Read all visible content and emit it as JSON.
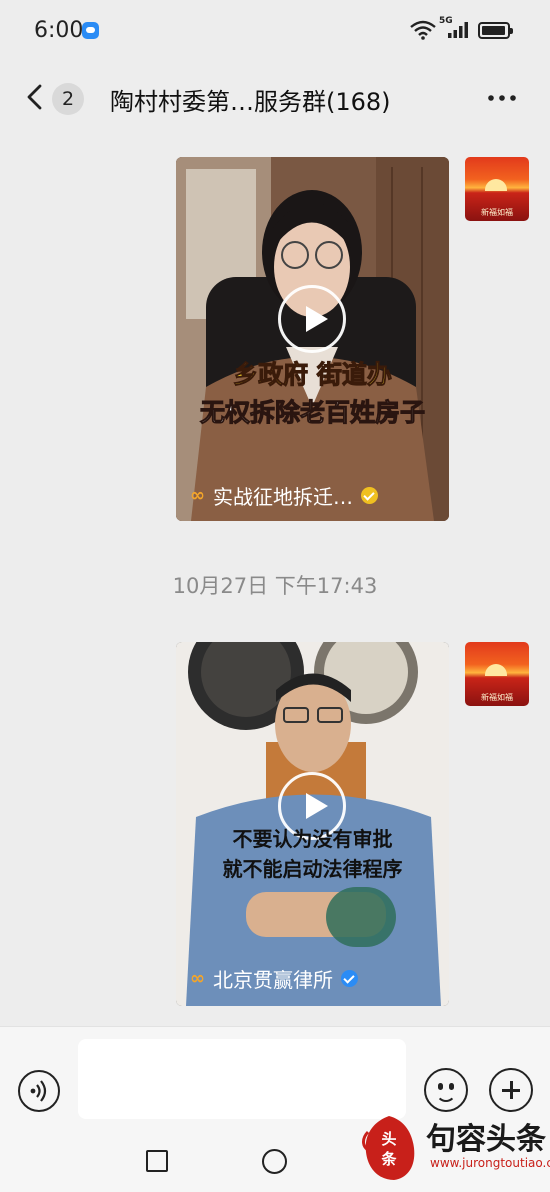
{
  "status_bar": {
    "time": "6:00",
    "network": "5G"
  },
  "header": {
    "unread_count": "2",
    "title": "陶村村委第…服务群(168)"
  },
  "messages": [
    {
      "caption_line1": "乡政府 街道办",
      "caption_line2": "无权拆除老百姓房子",
      "source": "实战征地拆迁…",
      "verified_color": "#f0c020"
    },
    {
      "caption_line1": "不要认为没有审批",
      "caption_line2": "就不能启动法律程序",
      "source": "北京贯赢律所",
      "verified_color": "#2b8cf5"
    }
  ],
  "avatar_label": "新福如福",
  "timestamp": "10月27日 下午17:43",
  "input": {
    "value": "",
    "placeholder": ""
  },
  "watermark": {
    "title": "句容头条",
    "url": "www.jurongtoutiao.com",
    "seal_text": "头条"
  },
  "colors": {
    "background": "#ededed",
    "brand_red": "#c8201a",
    "source_logo": "#f3a52a"
  },
  "icons": [
    "back-icon",
    "more-icon",
    "play-icon",
    "voice-icon",
    "emoji-icon",
    "plus-icon",
    "verified-icon",
    "wifi-icon",
    "signal-icon",
    "battery-icon"
  ]
}
